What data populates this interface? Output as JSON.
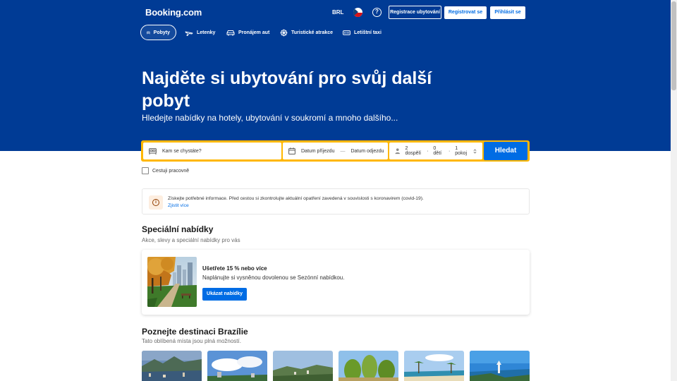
{
  "brand": {
    "logo": "Booking.com"
  },
  "header": {
    "currency": "BRL",
    "help_glyph": "?",
    "list_property": "Registrace ubytování",
    "register": "Registrovat se",
    "sign_in": "Přihlásit se"
  },
  "nav": [
    {
      "label": "Pobyty",
      "icon": "bed-icon",
      "active": true
    },
    {
      "label": "Letenky",
      "icon": "plane-icon",
      "active": false
    },
    {
      "label": "Pronájem aut",
      "icon": "car-icon",
      "active": false
    },
    {
      "label": "Turistické atrakce",
      "icon": "attractions-icon",
      "active": false
    },
    {
      "label": "Letištní taxi",
      "icon": "taxi-icon",
      "active": false
    }
  ],
  "hero": {
    "title": "Najděte si ubytování pro svůj další pobyt",
    "subtitle": "Hledejte nabídky na hotely, ubytování v soukromí a mnoho dalšího..."
  },
  "search": {
    "destination_placeholder": "Kam se chystáte?",
    "checkin": "Datum příjezdu",
    "date_separator": "—",
    "checkout": "Datum odjezdu",
    "adults": "2 dospělí",
    "children": "0 dětí",
    "rooms": "1 pokoj",
    "separator": "·",
    "button": "Hledat",
    "business_travel": "Cestuji pracovně"
  },
  "notice": {
    "icon_glyph": "i",
    "text": "Získejte potřebné informace. Před cestou si zkontrolujte aktuální opatření zavedená v souvislosti s koronavirem (covid-19).",
    "link": "Zjistit více"
  },
  "offers": {
    "title": "Speciální nabídky",
    "subtitle": "Akce, slevy a speciální nabídky pro vás",
    "card": {
      "title": "Ušetřete 15 % nebo více",
      "description": "Naplánujte si vysněnou dovolenou se Sezónní nabídkou.",
      "button": "Ukázat nabídky"
    }
  },
  "destinations": {
    "title": "Poznejte destinaci Brazílie",
    "subtitle": "Tato oblíbená místa jsou plná možností.",
    "items": [
      {
        "name": "destination-rio"
      },
      {
        "name": "destination-city-sky"
      },
      {
        "name": "destination-hills"
      },
      {
        "name": "destination-trees"
      },
      {
        "name": "destination-beach"
      },
      {
        "name": "destination-coast"
      }
    ]
  },
  "colors": {
    "brand_blue": "#003b95",
    "action_blue": "#006ce4",
    "search_border": "#ffb700"
  }
}
